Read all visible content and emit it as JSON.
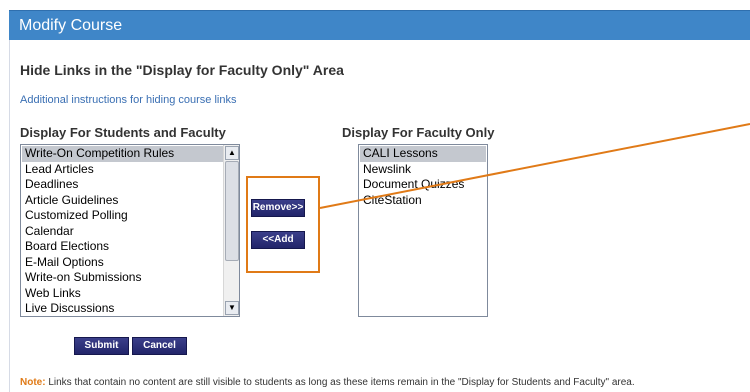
{
  "header": {
    "title": "Modify Course"
  },
  "section": {
    "heading": "Hide Links in the \"Display for Faculty Only\" Area"
  },
  "instructions_link": "Additional instructions for hiding course links",
  "left_list": {
    "label": "Display For Students and Faculty",
    "items": [
      "Write-On Competition Rules",
      "Lead Articles",
      "Deadlines",
      "Article Guidelines",
      "Customized Polling",
      "Calendar",
      "Board Elections",
      "E-Mail Options",
      "Write-on Submissions",
      "Web Links",
      "Live Discussions"
    ],
    "selected": "Write-On Competition Rules"
  },
  "right_list": {
    "label": "Display For Faculty Only",
    "items": [
      "CALI Lessons",
      "Newslink",
      "Document Quizzes",
      "CiteStation"
    ],
    "selected": "CALI Lessons"
  },
  "buttons": {
    "remove": "Remove>>",
    "add": "<<Add",
    "submit": "Submit",
    "cancel": "Cancel"
  },
  "note": {
    "label": "Note:",
    "text": " Links that contain no content are still visible to students as long as these items remain in the \"Display for Students and Faculty\" area."
  },
  "colors": {
    "header": "#3f86c8",
    "button": "#2b2e78",
    "highlight": "#e07a17",
    "link": "#3a6fb3"
  }
}
